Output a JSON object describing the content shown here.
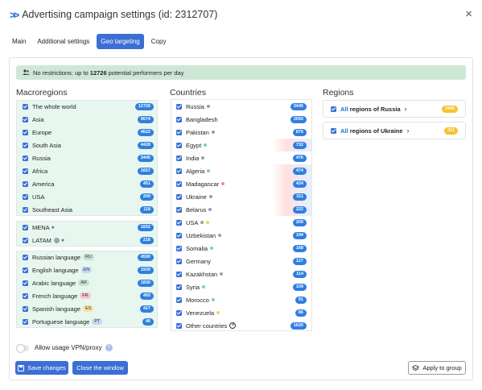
{
  "header": {
    "title": "Advertising campaign settings (id: 2312707)",
    "close": "×"
  },
  "tabs": [
    {
      "label": "Main",
      "active": false
    },
    {
      "label": "Additional settings",
      "active": false
    },
    {
      "label": "Geo targeting",
      "active": true
    },
    {
      "label": "Copy",
      "active": false
    }
  ],
  "banner": {
    "prefix": "No restrictions: up to",
    "count": "12726",
    "suffix": "potential performers per day"
  },
  "macroregions": {
    "title": "Macroregions",
    "groups": [
      [
        {
          "label": "The whole world",
          "count": "12726"
        },
        {
          "label": "Asia",
          "count": "9674"
        },
        {
          "label": "Europe",
          "count": "4622"
        },
        {
          "label": "South Asia",
          "count": "4428"
        },
        {
          "label": "Russia",
          "count": "3445"
        },
        {
          "label": "Africa",
          "count": "1657"
        },
        {
          "label": "America",
          "count": "451"
        },
        {
          "label": "USA",
          "count": "209"
        },
        {
          "label": "Southeast Asia",
          "count": "118"
        }
      ],
      [
        {
          "label": "MENA",
          "count": "1652",
          "icons": [
            "pin-icon"
          ]
        },
        {
          "label": "LATAM",
          "count": "218",
          "icons": [
            "globe-icon",
            "pin-icon"
          ]
        }
      ],
      [
        {
          "label": "Russian language",
          "count": "4590",
          "tag": "RU",
          "tag_color": "#c6e3cf"
        },
        {
          "label": "English language",
          "count": "1930",
          "tag": "EN",
          "tag_color": "#c6d7f3"
        },
        {
          "label": "Arabic language",
          "count": "1830",
          "tag": "AR",
          "tag_color": "#c6e3cf"
        },
        {
          "label": "French language",
          "count": "493",
          "tag": "FR",
          "tag_color": "#f6c6cc"
        },
        {
          "label": "Spanish language",
          "count": "427",
          "tag": "ES",
          "tag_color": "#f6e3a0"
        },
        {
          "label": "Portuguese language",
          "count": "46",
          "tag": "PT",
          "tag_color": "#c6d7f3"
        }
      ]
    ]
  },
  "countries": {
    "title": "Countries",
    "items": [
      {
        "label": "Russia",
        "count": "3445",
        "dot": "#9aa0a6",
        "striped": false
      },
      {
        "label": "Bangladesh",
        "count": "3050",
        "dot": null,
        "striped": false
      },
      {
        "label": "Pakistan",
        "count": "875",
        "dot": "#9aa0a6",
        "striped": false
      },
      {
        "label": "Egypt",
        "count": "732",
        "dot": "#7fd3a0",
        "striped": true
      },
      {
        "label": "India",
        "count": "476",
        "dot": "#9aa0a6",
        "striped": false
      },
      {
        "label": "Algeria",
        "count": "474",
        "dot": "#7fd3a0",
        "striped": true
      },
      {
        "label": "Madagascar",
        "count": "424",
        "dot": "#f08a9a",
        "striped": true
      },
      {
        "label": "Ukraine",
        "count": "311",
        "dot": "#9aa0a6",
        "striped": true
      },
      {
        "label": "Belarus",
        "count": "222",
        "dot": "#9aa0a6",
        "striped": true
      },
      {
        "label": "USA",
        "count": "209",
        "dot": "#9aa0a6",
        "dot2": "#f3d35e",
        "striped": false
      },
      {
        "label": "Uzbekistan",
        "count": "194",
        "dot": "#9aa0a6",
        "striped": false
      },
      {
        "label": "Somalia",
        "count": "168",
        "dot": "#7fd3a0",
        "striped": false
      },
      {
        "label": "Germany",
        "count": "127",
        "dot": null,
        "striped": false
      },
      {
        "label": "Kazakhstan",
        "count": "114",
        "dot": "#9aa0a6",
        "striped": false
      },
      {
        "label": "Syria",
        "count": "109",
        "dot": "#7fd3a0",
        "striped": false
      },
      {
        "label": "Morocco",
        "count": "91",
        "dot": "#7fd3a0",
        "striped": false
      },
      {
        "label": "Venezuela",
        "count": "86",
        "dot": "#f3d35e",
        "striped": false
      },
      {
        "label": "Other countries",
        "count": "1620",
        "dot": null,
        "plus": true,
        "striped": false
      }
    ]
  },
  "regions": {
    "title": "Regions",
    "items": [
      {
        "all": "All",
        "label": "regions of Russia",
        "count": "3445"
      },
      {
        "all": "All",
        "label": "regions of Ukraine",
        "count": "311"
      }
    ]
  },
  "vpn": {
    "label": "Allow usage VPN/proxy"
  },
  "buttons": {
    "save": "Save changes",
    "close": "Close the window",
    "apply": "Apply to group"
  },
  "colors": {
    "accent": "#3b6fd4",
    "badge": "#2f7fe0",
    "banner": "#cfe8d5",
    "region_badge": "#f3c234"
  }
}
